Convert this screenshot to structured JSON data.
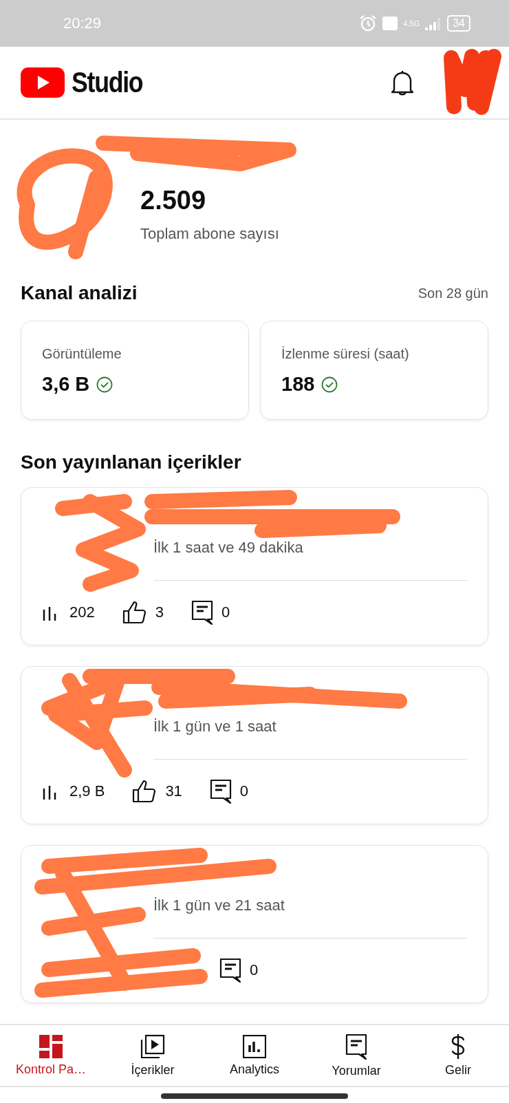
{
  "status_bar": {
    "time": "20:29",
    "network": "4.5G",
    "battery": "34"
  },
  "header": {
    "app_name": "Studio"
  },
  "channel": {
    "subscribers": "2.509",
    "subscribers_label": "Toplam abone sayısı"
  },
  "analytics": {
    "title": "Kanal analizi",
    "period": "Son 28 gün",
    "metrics": [
      {
        "label": "Görüntüleme",
        "value": "3,6 B"
      },
      {
        "label": "İzlenme süresi (saat)",
        "value": "188"
      }
    ]
  },
  "recent": {
    "title": "Son yayınlanan içerikler",
    "videos": [
      {
        "period": "İlk 1 saat ve 49 dakika",
        "stats": [
          {
            "kind": "views",
            "value": "202"
          },
          {
            "kind": "likes",
            "value": "3"
          },
          {
            "kind": "comments",
            "value": "0"
          }
        ]
      },
      {
        "period": "İlk 1 gün ve 1 saat",
        "stats": [
          {
            "kind": "views",
            "value": "2,9 B"
          },
          {
            "kind": "likes",
            "value": "31"
          },
          {
            "kind": "comments",
            "value": "0"
          }
        ]
      },
      {
        "period": "İlk 1 gün ve 21 saat",
        "stats": [
          {
            "kind": "comments",
            "value": "0"
          }
        ]
      }
    ]
  },
  "bottom_nav": [
    {
      "kind": "dashboard",
      "label": "Kontrol Pa…",
      "selected": true
    },
    {
      "kind": "content",
      "label": "İçerikler",
      "selected": false
    },
    {
      "kind": "analytics",
      "label": "Analytics",
      "selected": false
    },
    {
      "kind": "comments",
      "label": "Yorumlar",
      "selected": false
    },
    {
      "kind": "earn",
      "label": "Gelir",
      "selected": false
    }
  ]
}
